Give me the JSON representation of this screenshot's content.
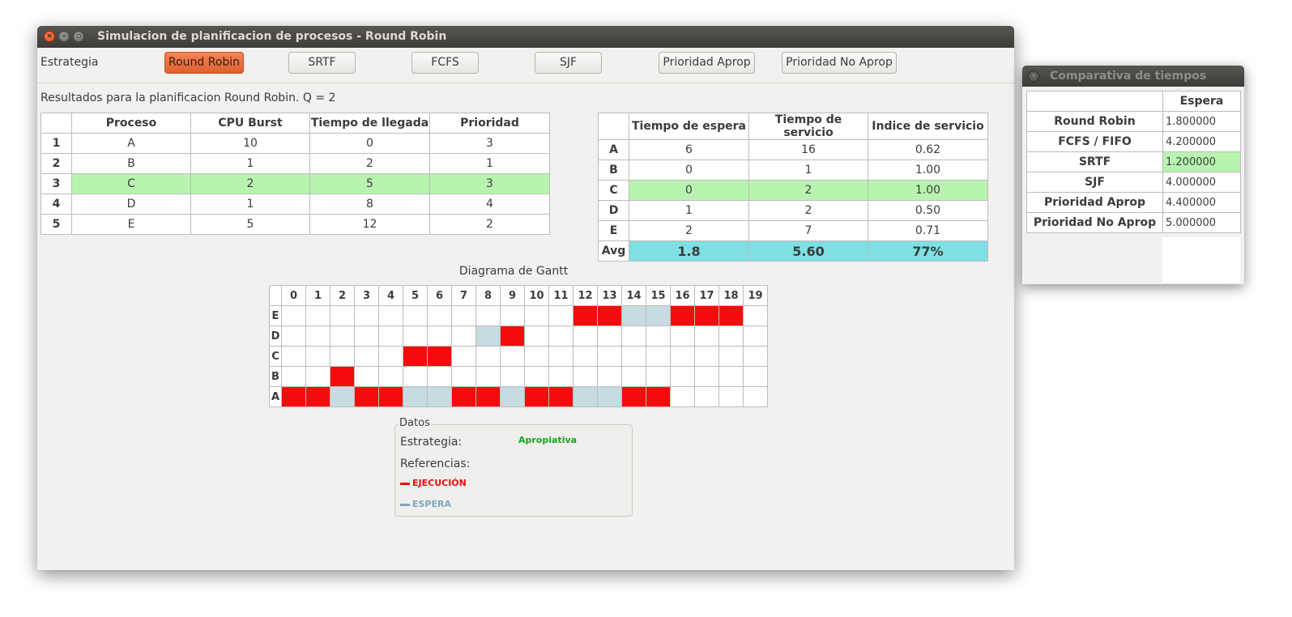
{
  "main_window": {
    "title": "Simulacion de planificacion de procesos - Round Robin"
  },
  "strategy": {
    "label": "Estrategia",
    "buttons": [
      "Round Robin",
      "SRTF",
      "FCFS",
      "SJF",
      "Prioridad Aprop",
      "Prioridad No Aprop"
    ],
    "active": "Round Robin"
  },
  "results_label": "Resultados para la planificacion Round Robin. Q = 2",
  "process_table": {
    "headers": [
      "Proceso",
      "CPU Burst",
      "Tiempo de llegada",
      "Prioridad"
    ],
    "rows": [
      {
        "num": "1",
        "cells": [
          "A",
          "10",
          "0",
          "3"
        ]
      },
      {
        "num": "2",
        "cells": [
          "B",
          "1",
          "2",
          "1"
        ]
      },
      {
        "num": "3",
        "cells": [
          "C",
          "2",
          "5",
          "3"
        ],
        "highlight": true
      },
      {
        "num": "4",
        "cells": [
          "D",
          "1",
          "8",
          "4"
        ]
      },
      {
        "num": "5",
        "cells": [
          "E",
          "5",
          "12",
          "2"
        ]
      }
    ]
  },
  "times_table": {
    "headers": [
      "Tiempo de espera",
      "Tiempo de servicio",
      "Indice de servicio"
    ],
    "rows": [
      {
        "label": "A",
        "cells": [
          "6",
          "16",
          "0.62"
        ]
      },
      {
        "label": "B",
        "cells": [
          "0",
          "1",
          "1.00"
        ]
      },
      {
        "label": "C",
        "cells": [
          "0",
          "2",
          "1.00"
        ],
        "highlight": true
      },
      {
        "label": "D",
        "cells": [
          "1",
          "2",
          "0.50"
        ]
      },
      {
        "label": "E",
        "cells": [
          "2",
          "7",
          "0.71"
        ]
      }
    ],
    "avg": {
      "label": "Avg",
      "cells": [
        "1.8",
        "5.60",
        "77%"
      ]
    }
  },
  "gantt": {
    "title": "Diagrama de Gantt",
    "columns": [
      "0",
      "1",
      "2",
      "3",
      "4",
      "5",
      "6",
      "7",
      "8",
      "9",
      "10",
      "11",
      "12",
      "13",
      "14",
      "15",
      "16",
      "17",
      "18",
      "19"
    ],
    "rows": [
      {
        "label": "E",
        "cells": "............EEWWEEE."
      },
      {
        "label": "D",
        "cells": "........WE.........."
      },
      {
        "label": "C",
        "cells": ".....EE............."
      },
      {
        "label": "B",
        "cells": "..E................."
      },
      {
        "label": "A",
        "cells": "EEWEEWWEEWEEWWEE...."
      }
    ],
    "legend_codes": {
      "E": "exec",
      "W": "wait"
    }
  },
  "datos": {
    "title": "Datos",
    "strategy_label": "Estrategia:",
    "strategy_value": "Apropiativa",
    "references_label": "Referencias:",
    "exec_label": "EJECUCIÓN",
    "wait_label": "ESPERA",
    "colors": {
      "exec": "#f40c0c",
      "wait": "#7da9bd",
      "strategy": "#14a81c"
    }
  },
  "comparison_window": {
    "title": "Comparativa de tiempos",
    "header": "Espera",
    "rows": [
      {
        "name": "Round Robin",
        "value": "1.800000"
      },
      {
        "name": "FCFS / FIFO",
        "value": "4.200000"
      },
      {
        "name": "SRTF",
        "value": "1.200000",
        "best": true
      },
      {
        "name": "SJF",
        "value": "4.000000"
      },
      {
        "name": "Prioridad Aprop",
        "value": "4.400000"
      },
      {
        "name": "Prioridad No Aprop",
        "value": "5.000000"
      }
    ]
  }
}
